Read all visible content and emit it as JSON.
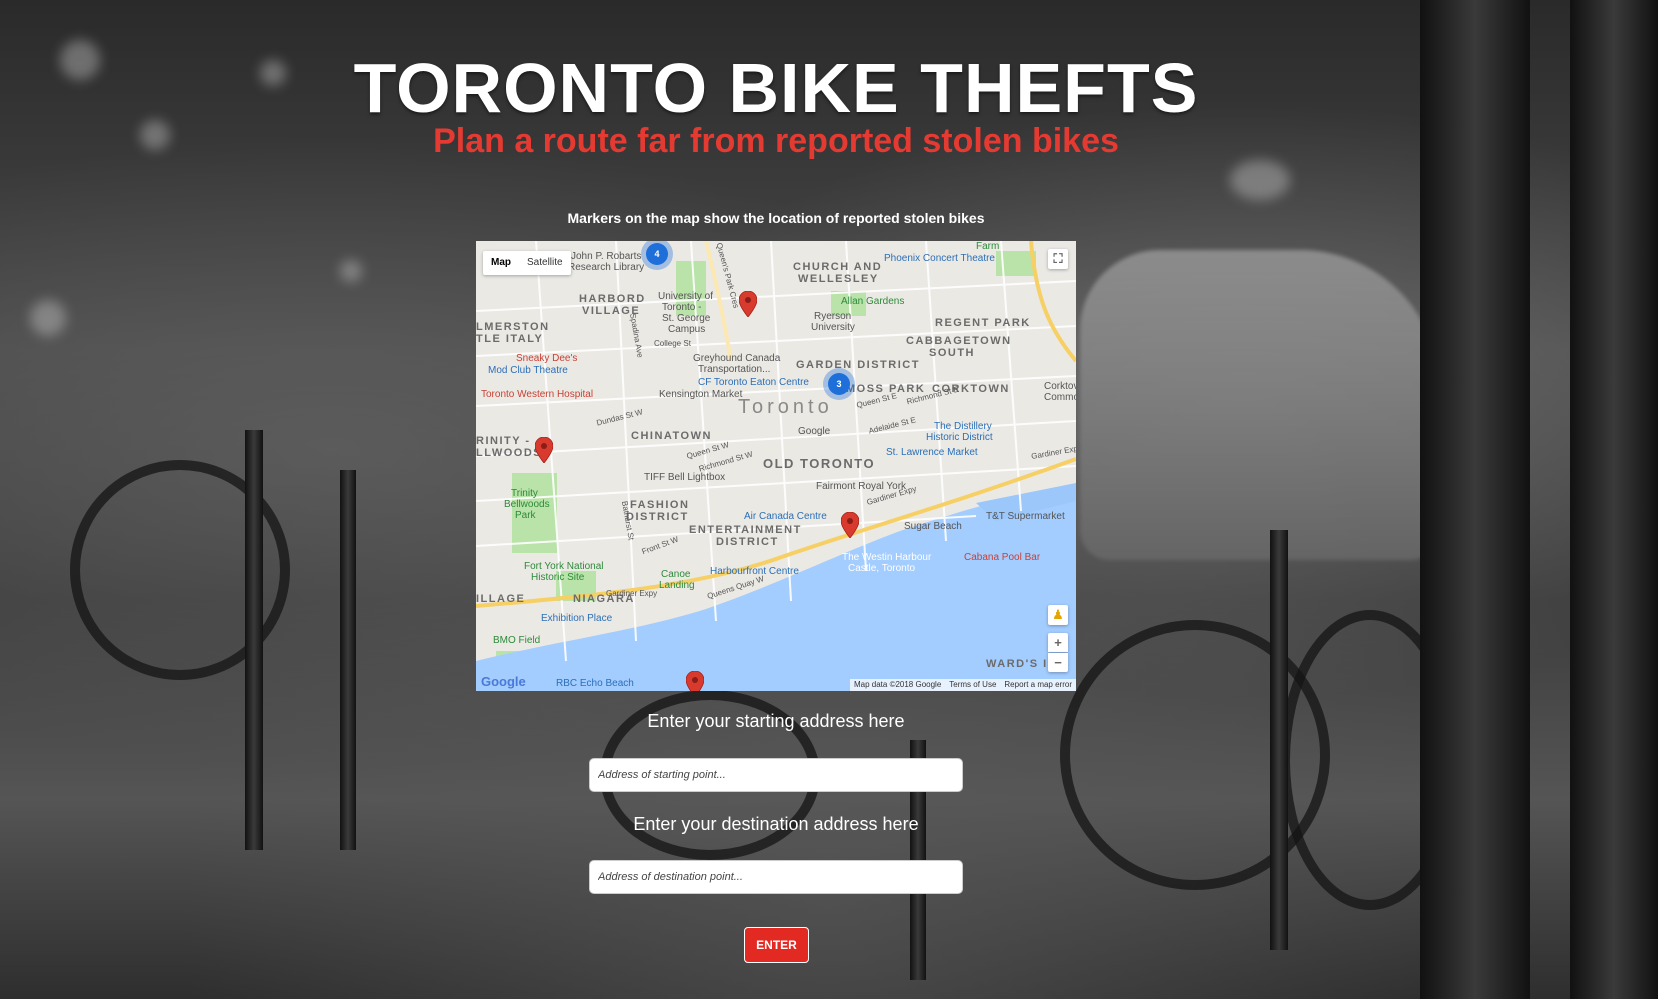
{
  "header": {
    "title": "TORONTO BIKE THEFTS",
    "subtitle": "Plan a route far from reported stolen bikes",
    "map_caption": "Markers on the map show the location of reported stolen bikes"
  },
  "map": {
    "type_control": {
      "map": "Map",
      "satellite": "Satellite",
      "selected": "Map"
    },
    "zoom_in": "+",
    "zoom_out": "−",
    "fullscreen_icon": "fullscreen-icon",
    "pegman_icon": "pegman-icon",
    "google_logo": "Google",
    "footer": {
      "data": "Map data ©2018 Google",
      "terms": "Terms of Use",
      "report": "Report a map error"
    },
    "labels": {
      "city": "Toronto",
      "church_wellesley": "CHURCH AND",
      "church_wellesley_2": "WELLESLEY",
      "harbord_village": "HARBORD",
      "harbord_village_2": "VILLAGE",
      "little_italy": "LMERSTON",
      "little_italy_2": "TLE ITALY",
      "regent_park": "REGENT PARK",
      "cabbagetown": "CABBAGETOWN",
      "cabbagetown_2": "SOUTH",
      "garden_district": "GARDEN DISTRICT",
      "moss_park": "MOSS PARK",
      "corktown": "CORKTOWN",
      "chinatown": "CHINATOWN",
      "old_toronto": "OLD TORONTO",
      "trinity": "RINITY -",
      "trinity_2": "LLWOODS",
      "fashion": "FASHION",
      "fashion_2": "DISTRICT",
      "entertainment": "ENTERTAINMENT",
      "entertainment_2": "DISTRICT",
      "niagara": "NIAGARA",
      "village": "ILLAGE",
      "wards": "WARD'S I",
      "john_robarts": "John P. Robarts",
      "john_robarts_2": "Research Library",
      "uoft": "University of",
      "uoft_2": "Toronto -",
      "uoft_3": "St. George",
      "uoft_4": "Campus",
      "ryerson": "Ryerson",
      "ryerson_2": "University",
      "allan_gardens": "Allan Gardens",
      "phoenix": "Phoenix Concert Theatre",
      "farm": "Farm",
      "sneaky_dees": "Sneaky Dee's",
      "mod_club": "Mod Club Theatre",
      "college_st": "College St",
      "greyhound": "Greyhound Canada",
      "greyhound_2": "Transportation...",
      "eaton": "CF Toronto Eaton Centre",
      "western_hospital": "Toronto Western Hospital",
      "kensington": "Kensington Market",
      "google_office": "Google",
      "distillery": "The Distillery",
      "distillery_2": "Historic District",
      "st_lawrence": "St. Lawrence Market",
      "fairmont": "Fairmont Royal York",
      "tiff": "TIFF Bell Lightbox",
      "trinity_park": "Trinity",
      "trinity_park_2": "Bellwoods",
      "trinity_park_3": "Park",
      "air_canada": "Air Canada Centre",
      "sugar_beach": "Sugar Beach",
      "tt": "T&T Supermarket",
      "cabana": "Cabana Pool Bar",
      "westin": "The Westin Harbour",
      "westin_2": "Castle, Toronto",
      "harbourfront": "Harbourfront Centre",
      "fort_york": "Fort York National",
      "fort_york_2": "Historic Site",
      "canoe": "Canoe",
      "canoe_2": "Landing",
      "exhibition": "Exhibition Place",
      "bmo": "BMO Field",
      "rbc": "RBC Echo Beach",
      "gardiner": "Gardiner Expy",
      "gardiner_2": "Gardiner Expy",
      "gardiner_3": "Gardiner Expy",
      "queens_quay": "Queens Quay W",
      "front_st": "Front St W",
      "dundas": "Dundas St W",
      "queen_st": "Queen St W",
      "richmond": "Richmond St W",
      "queen_st_e": "Queen St E",
      "richmond_e": "Richmond St E",
      "adelaide": "Adelaide St E",
      "bathurst": "Bathurst St",
      "spadina": "Spadina Ave",
      "queens_park": "Queen's Park Cres",
      "corktown_2": "Corktov",
      "commons": "Commo",
      "gardiner_e": "Gardiner Exp",
      "ch": "CH"
    },
    "clusters": [
      {
        "count": "4"
      },
      {
        "count": "3"
      }
    ]
  },
  "form": {
    "start_label": "Enter your starting address here",
    "start_placeholder": "Address of starting point...",
    "start_value": "",
    "dest_label": "Enter your destination address here",
    "dest_placeholder": "Address of destination point...",
    "dest_value": "",
    "enter_label": "ENTER"
  },
  "colors": {
    "accent": "#e53a32",
    "button": "#e22a23",
    "marker": "#d93a2e",
    "cluster": "#1e6fd9",
    "water": "#a3ccff",
    "park": "#b9e3a8"
  }
}
